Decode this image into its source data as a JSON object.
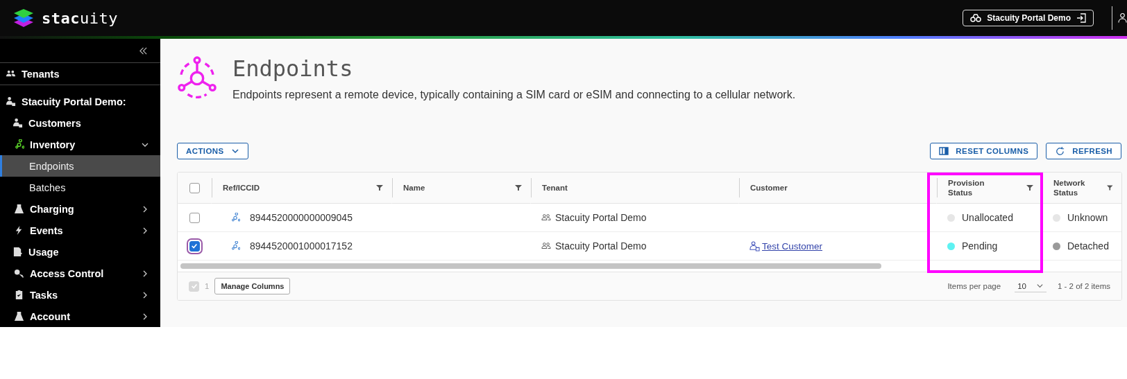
{
  "header": {
    "logo": "**stac**uity",
    "tenant_button": "Stacuity Portal Demo"
  },
  "sidebar": {
    "items": [
      {
        "label": "Tenants",
        "kind": "top",
        "selected": false
      },
      {
        "label": "Stacuity Portal Demo:",
        "kind": "section",
        "selected": false
      },
      {
        "label": "Customers",
        "kind": "link",
        "selected": false
      },
      {
        "label": "Inventory",
        "kind": "group",
        "expanded": true,
        "selected": false,
        "children": [
          {
            "label": "Endpoints",
            "kind": "sub",
            "selected": true
          },
          {
            "label": "Batches",
            "kind": "sub",
            "selected": false
          }
        ]
      },
      {
        "label": "Charging",
        "kind": "group",
        "expanded": false,
        "selected": false
      },
      {
        "label": "Events",
        "kind": "group",
        "expanded": false,
        "selected": false
      },
      {
        "label": "Usage",
        "kind": "link",
        "selected": false
      },
      {
        "label": "Access Control",
        "kind": "group",
        "expanded": false,
        "selected": false
      },
      {
        "label": "Tasks",
        "kind": "group",
        "expanded": false,
        "selected": false
      },
      {
        "label": "Account",
        "kind": "group",
        "expanded": false,
        "selected": false
      }
    ]
  },
  "page": {
    "title": "Endpoints",
    "description": "Endpoints represent a remote device, typically containing a SIM card or eSIM and connecting to a cellular network."
  },
  "toolbar": {
    "actions": "ACTIONS",
    "reset_columns": "RESET COLUMNS",
    "refresh": "REFRESH"
  },
  "table": {
    "header_checked": false,
    "columns": [
      {
        "label": "Ref/ICCID",
        "filter": true,
        "highlighted": false
      },
      {
        "label": "Name",
        "filter": true,
        "highlighted": false
      },
      {
        "label": "Tenant",
        "filter": false,
        "highlighted": false
      },
      {
        "label": "Customer",
        "filter": false,
        "highlighted": false
      },
      {
        "label": "Provision Status",
        "filter": true,
        "highlighted": true
      },
      {
        "label": "Network Status",
        "filter": true,
        "highlighted": false
      }
    ],
    "rows": [
      {
        "checked": false,
        "ref": "8944520000000009045",
        "tenant": "Stacuity Portal Demo",
        "provision": {
          "text": "Unallocated",
          "color": "#e6e6e6"
        },
        "network": {
          "text": "Unknown",
          "color": "#e6e6e6"
        }
      },
      {
        "checked": true,
        "ref": "8944520001000017152",
        "tenant": "Stacuity Portal Demo",
        "customer": "Test Customer",
        "provision": {
          "text": "Pending",
          "color": "#5ef2f2"
        },
        "network": {
          "text": "Detached",
          "color": "#9a9a9a"
        }
      }
    ],
    "footer": {
      "checked": true,
      "selected_count": "1",
      "manage_columns": "Manage Columns",
      "items_per_page_label": "Items per page",
      "items_per_page": "10",
      "range": "1 - 2 of 2 items"
    }
  }
}
